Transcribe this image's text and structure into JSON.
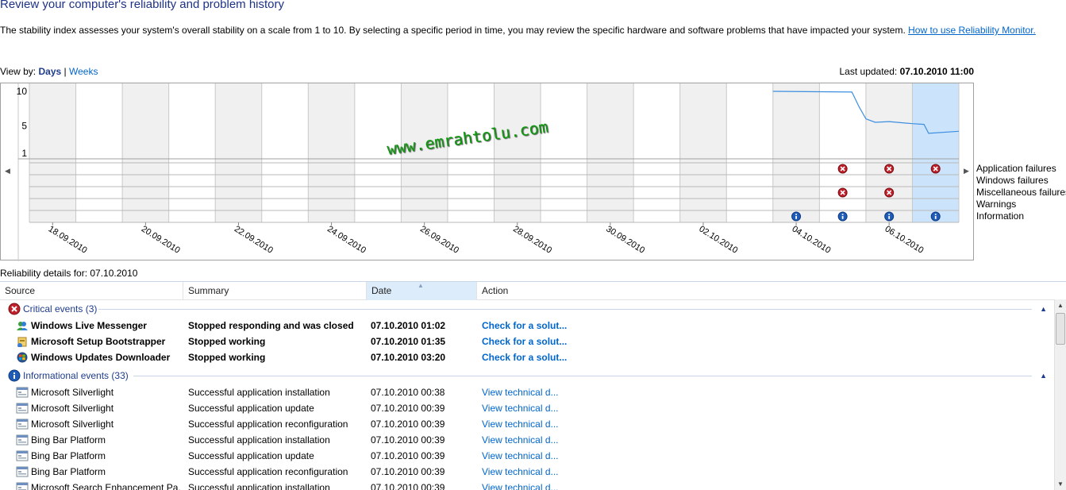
{
  "page": {
    "title": "Review your computer's reliability and problem history",
    "description": "The stability index assesses your system's overall stability on a scale from 1 to 10. By selecting a specific period in time, you may review the specific hardware and software problems that have impacted your system.",
    "help_link": "How to use Reliability Monitor.",
    "view_by_label": "View by:",
    "view_days": "Days",
    "view_separator": "|",
    "view_weeks": "Weeks",
    "last_updated_label": "Last updated:",
    "last_updated_value": "07.10.2010 11:00",
    "watermark": "www.emrahtolu.com",
    "details_label": "Reliability details for: 07.10.2010"
  },
  "chart_data": {
    "type": "line",
    "y_ticks": [
      "10",
      "5",
      "1"
    ],
    "ylim": [
      1,
      10
    ],
    "x_tick_labels": [
      "18.09.2010",
      "20.09.2010",
      "22.09.2010",
      "24.09.2010",
      "26.09.2010",
      "28.09.2010",
      "30.09.2010",
      "02.10.2010",
      "04.10.2010",
      "06.10.2010"
    ],
    "days": 20,
    "selected_day_index": 19,
    "stability_series": {
      "start_day_index": 16,
      "points": [
        {
          "d": 16.0,
          "v": 10.0
        },
        {
          "d": 17.7,
          "v": 9.9
        },
        {
          "d": 17.85,
          "v": 7.8
        },
        {
          "d": 18.0,
          "v": 6.0
        },
        {
          "d": 18.2,
          "v": 5.5
        },
        {
          "d": 18.5,
          "v": 5.6
        },
        {
          "d": 19.0,
          "v": 5.3
        },
        {
          "d": 19.25,
          "v": 5.2
        },
        {
          "d": 19.35,
          "v": 3.9
        },
        {
          "d": 20.0,
          "v": 4.2
        }
      ]
    },
    "row_labels": [
      "Application failures",
      "Windows failures",
      "Miscellaneous failures",
      "Warnings",
      "Information"
    ],
    "markers": [
      {
        "row": 0,
        "day": 17,
        "kind": "error"
      },
      {
        "row": 0,
        "day": 18,
        "kind": "error"
      },
      {
        "row": 0,
        "day": 19,
        "kind": "error"
      },
      {
        "row": 2,
        "day": 17,
        "kind": "error"
      },
      {
        "row": 2,
        "day": 18,
        "kind": "error"
      },
      {
        "row": 4,
        "day": 16,
        "kind": "info"
      },
      {
        "row": 4,
        "day": 17,
        "kind": "info"
      },
      {
        "row": 4,
        "day": 18,
        "kind": "info"
      },
      {
        "row": 4,
        "day": 19,
        "kind": "info"
      }
    ]
  },
  "table": {
    "columns": [
      "Source",
      "Summary",
      "Date",
      "Action"
    ],
    "sorted_column": "Date",
    "critical_group": "Critical events (3)",
    "info_group": "Informational events (33)",
    "critical_rows": [
      {
        "source": "Windows Live Messenger",
        "summary": "Stopped responding and was closed",
        "date": "07.10.2010 01:02",
        "action": "Check for a solut...",
        "icon": "messenger-icon"
      },
      {
        "source": "Microsoft Setup Bootstrapper",
        "summary": "Stopped working",
        "date": "07.10.2010 01:35",
        "action": "Check for a solut...",
        "icon": "setup-icon"
      },
      {
        "source": "Windows Updates Downloader",
        "summary": "Stopped working",
        "date": "07.10.2010 03:20",
        "action": "Check for a solut...",
        "icon": "windows-icon"
      }
    ],
    "info_rows": [
      {
        "source": "Microsoft Silverlight",
        "summary": "Successful application installation",
        "date": "07.10.2010 00:38",
        "action": "View  technical d..."
      },
      {
        "source": "Microsoft Silverlight",
        "summary": "Successful application update",
        "date": "07.10.2010 00:39",
        "action": "View  technical d..."
      },
      {
        "source": "Microsoft Silverlight",
        "summary": "Successful application reconfiguration",
        "date": "07.10.2010 00:39",
        "action": "View  technical d..."
      },
      {
        "source": "Bing Bar Platform",
        "summary": "Successful application installation",
        "date": "07.10.2010 00:39",
        "action": "View  technical d..."
      },
      {
        "source": "Bing Bar Platform",
        "summary": "Successful application update",
        "date": "07.10.2010 00:39",
        "action": "View  technical d..."
      },
      {
        "source": "Bing Bar Platform",
        "summary": "Successful application reconfiguration",
        "date": "07.10.2010 00:39",
        "action": "View  technical d..."
      },
      {
        "source": "Microsoft Search Enhancement Pa...",
        "summary": "Successful application installation",
        "date": "07.10.2010 00:39",
        "action": "View  technical d..."
      }
    ]
  },
  "colors": {
    "title": "#1e3287",
    "link": "#0066cc",
    "shade": "#f0f0f0",
    "selected": "#cce4fb",
    "line": "#3c8ee0",
    "error": "#c0202a",
    "info": "#1e5cb8"
  }
}
